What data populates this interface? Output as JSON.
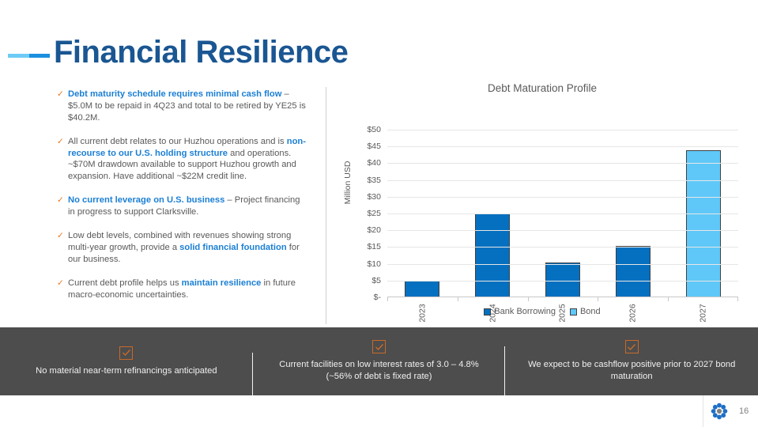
{
  "title": "Financial Resilience",
  "bullets": [
    {
      "tick": "✓",
      "segments": [
        {
          "text": "Debt maturity schedule requires minimal cash flow",
          "bold": true
        },
        {
          "text": " – $5.0M to be repaid in 4Q23 and total to be retired by YE25 is $40.2M.",
          "bold": false
        }
      ]
    },
    {
      "tick": "✓",
      "segments": [
        {
          "text": "All current debt relates to our Huzhou operations and is ",
          "bold": false
        },
        {
          "text": "non-recourse to our U.S. holding structure",
          "bold": true
        },
        {
          "text": " and operations. ~$70M drawdown available to support Huzhou growth and expansion. Have additional ~$22M credit line.",
          "bold": false
        }
      ]
    },
    {
      "tick": "✓",
      "segments": [
        {
          "text": "No current leverage on U.S. business",
          "bold": true
        },
        {
          "text": " – Project financing in progress to support Clarksville.",
          "bold": false
        }
      ]
    },
    {
      "tick": "✓",
      "segments": [
        {
          "text": "Low debt levels, combined with revenues showing strong multi-year growth, provide a ",
          "bold": false
        },
        {
          "text": "solid financial foundation",
          "bold": true
        },
        {
          "text": " for our business.",
          "bold": false
        }
      ]
    },
    {
      "tick": "✓",
      "segments": [
        {
          "text": "Current debt profile helps us ",
          "bold": false
        },
        {
          "text": "maintain resilience",
          "bold": true
        },
        {
          "text": " in future macro-economic uncertainties.",
          "bold": false
        }
      ]
    }
  ],
  "chart_data": {
    "type": "bar",
    "title": "Debt Maturation Profile",
    "xlabel": "",
    "ylabel": "Million USD",
    "categories": [
      "2023",
      "2024",
      "2025",
      "2026",
      "2027"
    ],
    "ylim": [
      0,
      50
    ],
    "ytick_values": [
      50,
      45,
      40,
      35,
      30,
      25,
      20,
      15,
      10,
      5,
      0
    ],
    "ytick_labels": [
      "$50",
      "$45",
      "$40",
      "$35",
      "$30",
      "$25",
      "$20",
      "$15",
      "$10",
      "$5",
      "$-"
    ],
    "grid": true,
    "legend_position": "bottom",
    "series": [
      {
        "name": "Bank Borrowing",
        "color": "#0570C0",
        "values": [
          5.0,
          25.1,
          10.3,
          15.3,
          null
        ]
      },
      {
        "name": "Bond",
        "color": "#5FC8F8",
        "values": [
          null,
          null,
          null,
          null,
          43.8
        ]
      }
    ],
    "bar_series_per_category": [
      "Bank Borrowing",
      "Bank Borrowing",
      "Bank Borrowing",
      "Bank Borrowing",
      "Bond"
    ],
    "bar_values": [
      5.0,
      25.1,
      10.3,
      15.3,
      43.8
    ]
  },
  "band": {
    "check_icon": "checkbox-check",
    "items": [
      {
        "text": "No material near-term refinancings anticipated"
      },
      {
        "text": "Current facilities on low interest rates of 3.0 – 4.8% (~56% of debt is fixed rate)"
      },
      {
        "text": "We expect to be cashflow positive prior to 2027 bond maturation"
      }
    ]
  },
  "footer": {
    "page_number": "16",
    "logo_name": "company-flower-logo"
  },
  "colors": {
    "title_blue": "#1A5692",
    "accent_blue": "#1B7FD4",
    "orange": "#E8771F",
    "band_gray": "#4D4D4D",
    "bar_dark": "#0570C0",
    "bar_light": "#5FC8F8"
  }
}
